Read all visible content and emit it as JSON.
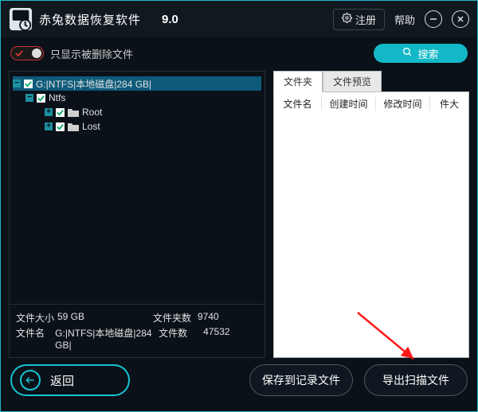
{
  "app": {
    "title": "赤兔数据恢复软件",
    "version": "9.0"
  },
  "titlebar": {
    "register_label": "注册",
    "help_label": "帮助"
  },
  "filter": {
    "label": "只显示被删除文件",
    "search_label": "搜索"
  },
  "tree": {
    "root_label": "G:|NTFS|本地磁盘|284 GB|",
    "ntfs_label": "Ntfs",
    "root_folder_label": "Root",
    "lost_folder_label": "Lost"
  },
  "stats": {
    "size_label": "文件大小",
    "size_value": "59 GB",
    "folders_label": "文件夹数",
    "folders_value": "9740",
    "name_label": "文件名",
    "name_value": "G:|NTFS|本地磁盘|284 GB|",
    "files_label": "文件数",
    "files_value": "47532"
  },
  "tabs": {
    "folder": "文件夹",
    "preview": "文件预览"
  },
  "columns": {
    "name": "文件名",
    "created": "创建时间",
    "modified": "修改时间",
    "size": "件大"
  },
  "buttons": {
    "back": "返回",
    "save_log": "保存到记录文件",
    "export_scan": "导出扫描文件"
  },
  "colors": {
    "accent": "#15c4d2"
  }
}
